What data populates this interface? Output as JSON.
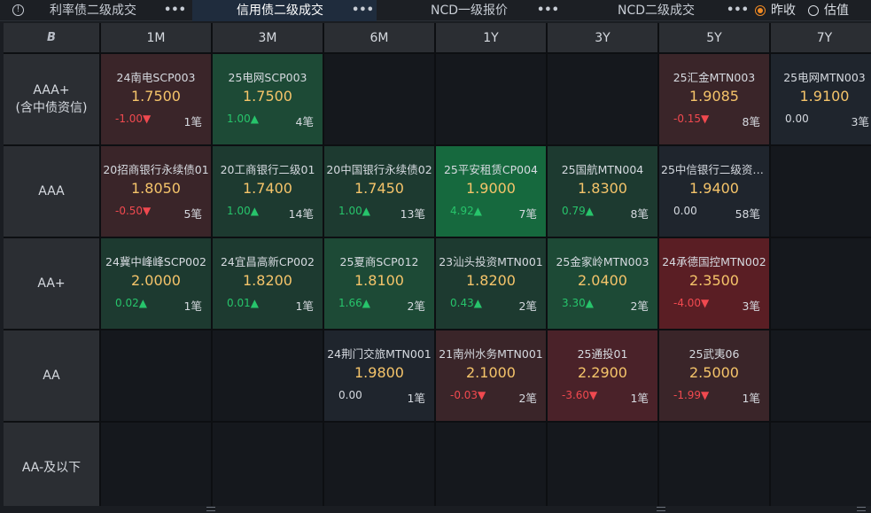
{
  "tabs": [
    {
      "label": "利率债二级成交",
      "more": "•••"
    },
    {
      "label": "信用债二级成交",
      "more": "•••"
    },
    {
      "label": "NCD一级报价",
      "more": "•••"
    },
    {
      "label": "NCD二级成交",
      "more": "•••"
    }
  ],
  "radios": [
    {
      "label": "昨收",
      "checked": true
    },
    {
      "label": "估值",
      "checked": false
    }
  ],
  "colors": {
    "up_strong": "#16693e",
    "up_mid": "#1d4a36",
    "up_weak": "#1d3a30",
    "down_strong": "#5a1e24",
    "down_mid": "#4a2229",
    "down_weak": "#3a2529",
    "neutral": "#1f252d",
    "price": "#f5c46a"
  },
  "grid": {
    "corner_icon": "B",
    "columns": [
      "1M",
      "3M",
      "6M",
      "1Y",
      "3Y",
      "5Y",
      "7Y"
    ],
    "rows": [
      {
        "label": [
          "AAA+",
          "(含中债资信)"
        ],
        "cells": [
          {
            "name": "24南电SCP003",
            "price": "1.7500",
            "chg": "-1.00▼",
            "dir": "down",
            "cnt": "1笔",
            "tone": "down_weak"
          },
          {
            "name": "25电网SCP003",
            "price": "1.7500",
            "chg": "1.00▲",
            "dir": "up",
            "cnt": "4笔",
            "tone": "up_mid"
          },
          null,
          null,
          null,
          {
            "name": "25汇金MTN003",
            "price": "1.9085",
            "chg": "-0.15▼",
            "dir": "down",
            "cnt": "8笔",
            "tone": "down_weak"
          },
          {
            "name": "25电网MTN003",
            "price": "1.9100",
            "chg": "0.00",
            "dir": "flat",
            "cnt": "3笔",
            "tone": "neutral"
          }
        ]
      },
      {
        "label": [
          "AAA"
        ],
        "cells": [
          {
            "name": "20招商银行永续债01",
            "price": "1.8050",
            "chg": "-0.50▼",
            "dir": "down",
            "cnt": "5笔",
            "tone": "down_weak"
          },
          {
            "name": "20工商银行二级01",
            "price": "1.7400",
            "chg": "1.00▲",
            "dir": "up",
            "cnt": "14笔",
            "tone": "up_weak"
          },
          {
            "name": "20中国银行永续债02",
            "price": "1.7450",
            "chg": "1.00▲",
            "dir": "up",
            "cnt": "13笔",
            "tone": "up_weak"
          },
          {
            "name": "25平安租赁CP004",
            "price": "1.9000",
            "chg": "4.92▲",
            "dir": "up",
            "cnt": "7笔",
            "tone": "up_strong"
          },
          {
            "name": "25国航MTN004",
            "price": "1.8300",
            "chg": "0.79▲",
            "dir": "up",
            "cnt": "8笔",
            "tone": "up_weak"
          },
          {
            "name": "25中信银行二级资本...",
            "price": "1.9400",
            "chg": "0.00",
            "dir": "flat",
            "cnt": "58笔",
            "tone": "neutral"
          },
          null
        ]
      },
      {
        "label": [
          "AA+"
        ],
        "cells": [
          {
            "name": "24冀中峰峰SCP002",
            "price": "2.0000",
            "chg": "0.02▲",
            "dir": "up",
            "cnt": "1笔",
            "tone": "up_weak"
          },
          {
            "name": "24宜昌高新CP002",
            "price": "1.8200",
            "chg": "0.01▲",
            "dir": "up",
            "cnt": "1笔",
            "tone": "up_weak"
          },
          {
            "name": "25夏商SCP012",
            "price": "1.8100",
            "chg": "1.66▲",
            "dir": "up",
            "cnt": "2笔",
            "tone": "up_mid"
          },
          {
            "name": "23汕头投资MTN001",
            "price": "1.8200",
            "chg": "0.43▲",
            "dir": "up",
            "cnt": "2笔",
            "tone": "up_weak"
          },
          {
            "name": "25金家岭MTN003",
            "price": "2.0400",
            "chg": "3.30▲",
            "dir": "up",
            "cnt": "2笔",
            "tone": "up_mid"
          },
          {
            "name": "24承德国控MTN002",
            "price": "2.3500",
            "chg": "-4.00▼",
            "dir": "down",
            "cnt": "3笔",
            "tone": "down_strong"
          },
          null
        ]
      },
      {
        "label": [
          "AA"
        ],
        "cells": [
          null,
          null,
          {
            "name": "24荆门交旅MTN001",
            "price": "1.9800",
            "chg": "0.00",
            "dir": "flat",
            "cnt": "1笔",
            "tone": "neutral"
          },
          {
            "name": "21南州水务MTN001",
            "price": "2.1000",
            "chg": "-0.03▼",
            "dir": "down",
            "cnt": "2笔",
            "tone": "down_weak"
          },
          {
            "name": "25通投01",
            "price": "2.2900",
            "chg": "-3.60▼",
            "dir": "down",
            "cnt": "1笔",
            "tone": "down_mid"
          },
          {
            "name": "25武夷06",
            "price": "2.5000",
            "chg": "-1.99▼",
            "dir": "down",
            "cnt": "1笔",
            "tone": "down_weak"
          },
          null
        ]
      },
      {
        "label": [
          "AA-及以下"
        ],
        "cells": [
          null,
          null,
          null,
          null,
          null,
          null,
          null
        ]
      }
    ]
  }
}
